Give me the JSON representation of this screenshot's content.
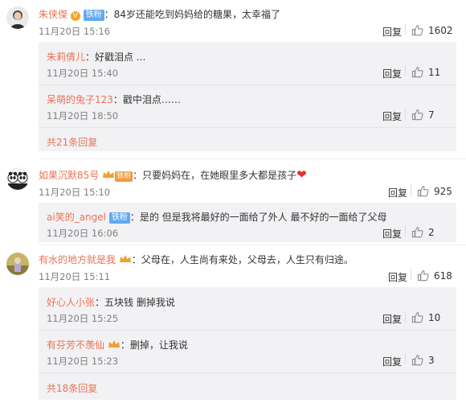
{
  "comments": [
    {
      "user": "朱侠傑",
      "verified": true,
      "badge": "铁粉",
      "text": "：84岁还能吃到妈妈给的糖果，太幸福了",
      "time": "11月20日 15:16",
      "reply": "回复",
      "likes": "1602",
      "subreplies": [
        {
          "user": "朱莉倩儿",
          "text": "：好戳泪点 ...",
          "time": "11月20日 15:40",
          "reply": "回复",
          "likes": "11"
        },
        {
          "user": "呆萌的兔子123",
          "text": "：戳中泪点……",
          "time": "11月20日 18:50",
          "reply": "回复",
          "likes": "7"
        }
      ],
      "more": "共21条回复"
    },
    {
      "user": "如果沉默85号",
      "badge": "铁粉",
      "text": "：只要妈妈在，在她眼里多大都是孩子",
      "heart": "❤",
      "time": "11月20日 15:10",
      "reply": "回复",
      "likes": "925",
      "subreplies": [
        {
          "user": "ai笑的_angel",
          "badge": "铁粉",
          "text": "：是的 但是我将最好的一面给了外人 最不好的一面给了父母",
          "time": "11月20日 16:06",
          "reply": "回复",
          "likes": "2"
        }
      ]
    },
    {
      "user": "有水的地方就是我",
      "text": "：父母在，人生尚有来处，父母去，人生只有归途。",
      "time": "11月20日 15:11",
      "reply": "回复",
      "likes": "618",
      "subreplies": [
        {
          "user": "好心人小张",
          "text": "：五块钱  删掉我说",
          "time": "11月20日 15:25",
          "reply": "回复",
          "likes": "10"
        },
        {
          "user": "有芬芳不羡仙",
          "text": "：删掉，让我说",
          "time": "11月20日 15:23",
          "reply": "回复",
          "likes": "3"
        }
      ],
      "more": "共18条回复"
    }
  ],
  "colors": {
    "username": "#eb7350",
    "badge_blue": "#60a9f0",
    "subreply_bg": "#f2f2f5"
  }
}
